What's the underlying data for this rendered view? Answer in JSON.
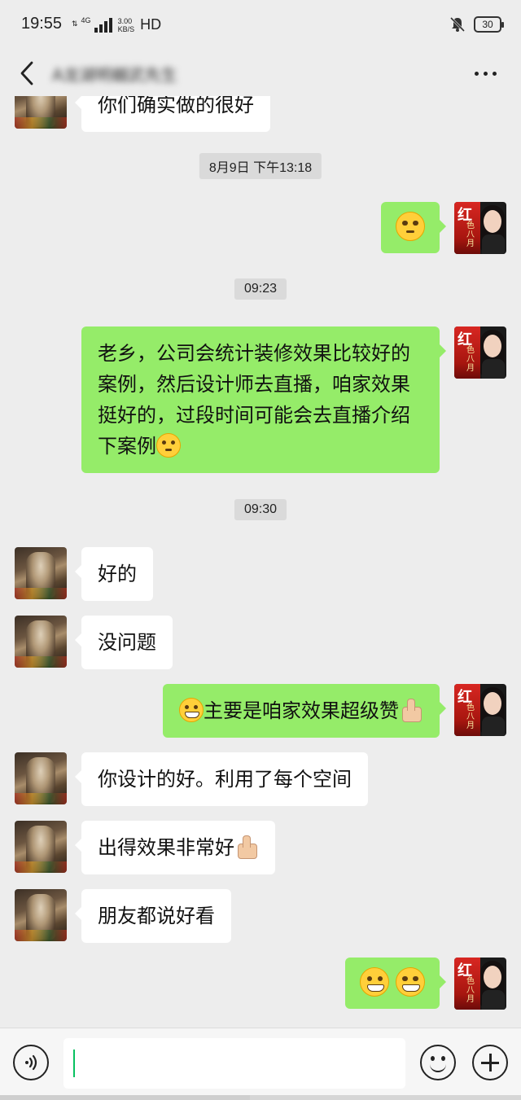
{
  "status_bar": {
    "time": "19:55",
    "network": "4G",
    "speed_value": "3.00",
    "speed_unit": "KB/S",
    "hd": "HD",
    "battery": "30"
  },
  "header": {
    "contact_name": "A龙湖明樾武先生",
    "back_icon": "chevron-left-icon",
    "more_icon": "more-dots-icon"
  },
  "messages": {
    "top_partial": "你们确实做的很好",
    "time1": "8月9日 下午13:18",
    "time2": "09:23",
    "time3": "09:30",
    "sent_long": "老乡，公司会统计装修效果比较好的案例，然后设计师去直播，咱家效果挺好的，过段时间可能会去直播介绍下案例",
    "recv_ok": "好的",
    "recv_no_problem": "没问题",
    "sent_praise": "主要是咱家效果超级赞",
    "recv_design": "你设计的好。利用了每个空间",
    "recv_effect": "出得效果非常好",
    "recv_friends": "朋友都说好看"
  },
  "avatar_right": {
    "poster_char": "红",
    "poster_sub": "色八月"
  },
  "input_bar": {
    "voice_icon": "voice-icon",
    "emoji_icon": "emoji-icon",
    "plus_icon": "plus-icon",
    "input_value": ""
  },
  "colors": {
    "chat_bg": "#ededed",
    "sent_bubble": "#95ec69",
    "received_bubble": "#ffffff",
    "caret": "#07c160"
  }
}
